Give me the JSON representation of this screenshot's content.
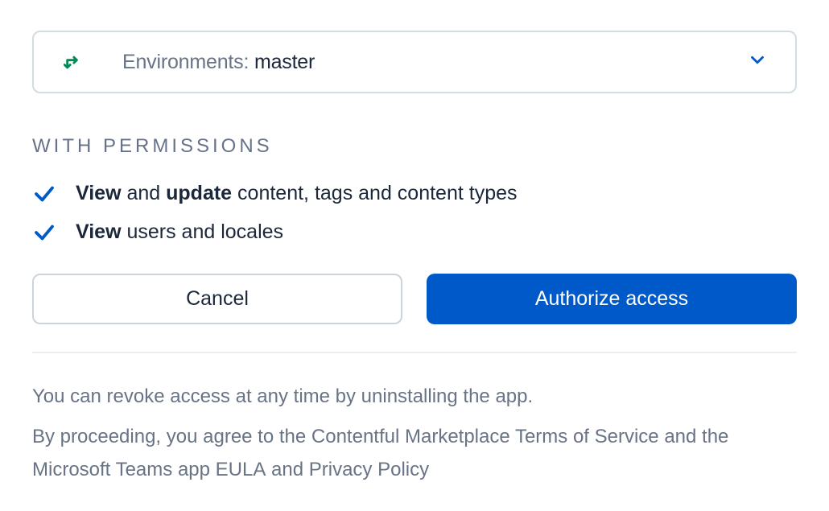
{
  "dropdown": {
    "prefix": "Environments: ",
    "value": "master"
  },
  "section_label": "WITH PERMISSIONS",
  "permissions": [
    {
      "b1": "View",
      "t1": " and ",
      "b2": "update",
      "t2": " content, tags and content types"
    },
    {
      "b1": "View",
      "t1": " users and locales",
      "b2": "",
      "t2": ""
    }
  ],
  "buttons": {
    "cancel": "Cancel",
    "authorize": "Authorize access"
  },
  "footer": {
    "line1": "You can revoke access at any time by uninstalling the app.",
    "line2_a": "By proceeding, you agree to the ",
    "line2_link1": "Contentful Marketplace Terms of Service",
    "line2_b": " and the Microsoft Teams app ",
    "line2_link2": "EULA",
    "line2_c": " and ",
    "line2_link3": "Privacy Policy"
  }
}
